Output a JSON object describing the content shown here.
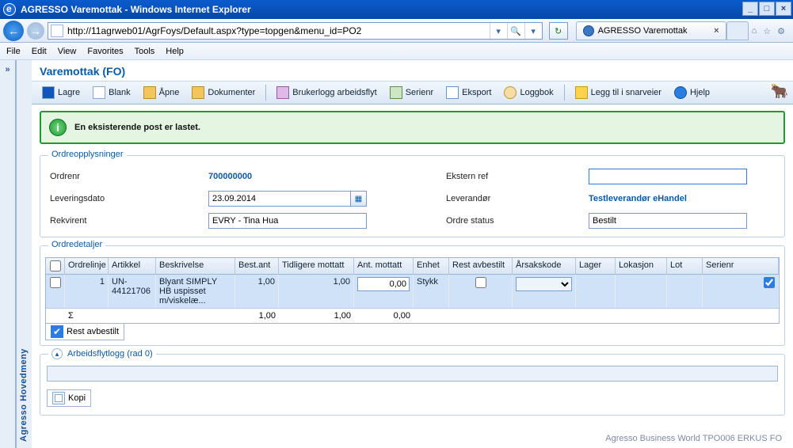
{
  "window": {
    "title": "AGRESSO Varemottak - Windows Internet Explorer"
  },
  "nav": {
    "url": "http://11agrweb01/AgrFoys/Default.aspx?type=topgen&menu_id=PO2",
    "tab_title": "AGRESSO Varemottak"
  },
  "menus": {
    "file": "File",
    "edit": "Edit",
    "view": "View",
    "favorites": "Favorites",
    "tools": "Tools",
    "help": "Help"
  },
  "sidebar": {
    "label": "Agresso Hovedmeny",
    "toggle": "»"
  },
  "page": {
    "title": "Varemottak (FO)"
  },
  "toolbar": {
    "lagre": "Lagre",
    "blank": "Blank",
    "apne": "Åpne",
    "dokumenter": "Dokumenter",
    "brukerlogg": "Brukerlogg arbeidsflyt",
    "serienr": "Serienr",
    "eksport": "Eksport",
    "loggbok": "Loggbok",
    "snarveier": "Legg til i snarveier",
    "hjelp": "Hjelp"
  },
  "message": {
    "text": "En eksisterende post er lastet."
  },
  "order_section": {
    "legend": "Ordreopplysninger",
    "labels": {
      "ordrenr": "Ordrenr",
      "leveringsdato": "Leveringsdato",
      "rekvirent": "Rekvirent",
      "ekstern_ref": "Ekstern ref",
      "leverandor": "Leverandør",
      "ordre_status": "Ordre status"
    },
    "values": {
      "ordrenr": "700000000",
      "leveringsdato": "23.09.2014",
      "rekvirent": "EVRY - Tina Hua",
      "ekstern_ref": "",
      "leverandor": "Testleverandør eHandel",
      "ordre_status": "Bestilt"
    }
  },
  "details": {
    "legend": "Ordredetaljer",
    "columns": [
      "",
      "Ordrelinje",
      "Artikkel",
      "Beskrivelse",
      "Best.ant",
      "Tidligere mottatt",
      "Ant. mottatt",
      "Enhet",
      "Rest avbestilt",
      "Årsakskode",
      "Lager",
      "Lokasjon",
      "Lot",
      "Serienr"
    ],
    "row": {
      "ordrelinje": "1",
      "artikkel": "UN-44121706",
      "beskrivelse": "Blyant SIMPLY HB uspisset m/viskelæ...",
      "best_ant": "1,00",
      "tidligere": "1,00",
      "ant_mottatt": "0,00",
      "enhet": "Stykk",
      "rest_avbestilt": false,
      "arsakskode": "",
      "lager": "",
      "lokasjon": "",
      "lot": "",
      "serienr": true
    },
    "sum_symbol": "Σ",
    "sum": {
      "best_ant": "1,00",
      "tidligere": "1,00",
      "ant_mottatt": "0,00"
    },
    "footer_btn": "Rest avbestilt"
  },
  "workflow": {
    "legend": "Arbeidsflytlogg (rad 0)",
    "kopi": "Kopi"
  },
  "footer": {
    "text": "Agresso Business World   TPO006   ERKUS   FO"
  }
}
